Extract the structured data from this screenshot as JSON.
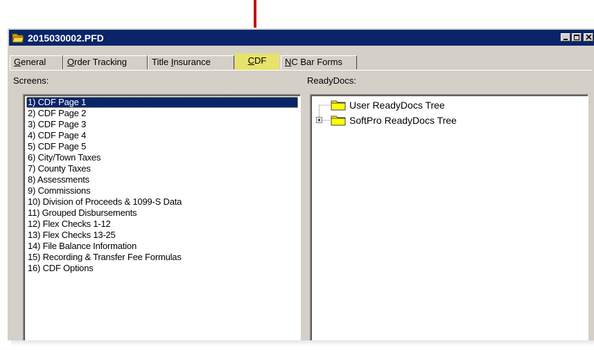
{
  "window": {
    "title": "2015030002.PFD",
    "title_icon": "open-folder-icon"
  },
  "tabs": [
    {
      "pre": "",
      "ul": "G",
      "post": "eneral"
    },
    {
      "pre": "",
      "ul": "O",
      "post": "rder Tracking"
    },
    {
      "pre": "Title ",
      "ul": "I",
      "post": "nsurance"
    },
    {
      "pre": "",
      "ul": "C",
      "post": "DF"
    },
    {
      "pre": "",
      "ul": "N",
      "post": "C Bar Forms"
    }
  ],
  "active_tab_index": 3,
  "colors": {
    "titlebar": "#0a246a",
    "active_tab": "#e6e26c",
    "arrow": "#c0121b",
    "selection": "#0a246a"
  },
  "screens": {
    "label": "Screens:",
    "items": [
      "1) CDF Page 1",
      "2) CDF Page 2",
      "3) CDF Page 3",
      "4) CDF Page 4",
      "5) CDF Page 5",
      "6) City/Town Taxes",
      "7) County Taxes",
      "8) Assessments",
      "9) Commissions",
      "10) Division of Proceeds & 1099-S Data",
      "11) Grouped Disbursements",
      "12) Flex Checks  1-12",
      "13) Flex Checks 13-25",
      "14) File Balance Information",
      "15) Recording & Transfer Fee Formulas",
      "16) CDF Options"
    ],
    "selected_index": 0
  },
  "readydocs": {
    "label": "ReadyDocs:",
    "tree": [
      {
        "label": "User ReadyDocs Tree",
        "expandable": false
      },
      {
        "label": "SoftPro ReadyDocs Tree",
        "expandable": true
      }
    ]
  }
}
